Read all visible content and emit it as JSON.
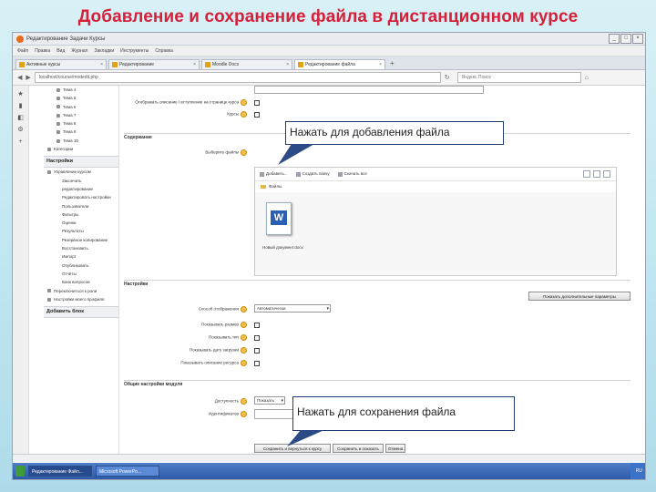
{
  "slide": {
    "title": "Добавление и сохранение файла в дистанционном курсе"
  },
  "browser": {
    "window_title": "Редактирование Задачи Курсы",
    "menu": [
      "Файл",
      "Правка",
      "Вид",
      "Журнал",
      "Закладки",
      "Инструменты",
      "Справка"
    ],
    "tabs": [
      {
        "label": "Активные курсы"
      },
      {
        "label": "Редактирование"
      },
      {
        "label": "Moodle Docs"
      },
      {
        "label": "Редактирование файла"
      }
    ],
    "url": "localhost/course/modedit.php",
    "search_placeholder": "Яндекс.Поиск"
  },
  "sidebar": {
    "topics": [
      "Тема 4",
      "Тема 5",
      "Тема 6",
      "Тема 7",
      "Тема 8",
      "Тема 9",
      "Тема 10",
      "Категории"
    ],
    "settings_title": "Настройки",
    "settings_items": [
      {
        "label": "Управление курсом",
        "level": 0
      },
      {
        "label": "Закончить",
        "level": 1
      },
      {
        "label": "редактирование",
        "level": 1
      },
      {
        "label": "Редактировать настройки",
        "level": 1
      },
      {
        "label": "Пользователи",
        "level": 1
      },
      {
        "label": "Фильтры",
        "level": 1
      },
      {
        "label": "Оценки",
        "level": 1
      },
      {
        "label": "Результаты",
        "level": 1
      },
      {
        "label": "Резервное копирование",
        "level": 1
      },
      {
        "label": "Восстановить",
        "level": 1
      },
      {
        "label": "Импорт",
        "level": 1
      },
      {
        "label": "Опубликовать",
        "level": 1
      },
      {
        "label": "Отчёты",
        "level": 1
      },
      {
        "label": "Банк вопросов",
        "level": 1
      },
      {
        "label": "Переключиться к роли",
        "level": 0
      },
      {
        "label": "Настройки моего профиля",
        "level": 0
      }
    ],
    "add_block": "Добавить блок"
  },
  "form": {
    "checkbox_label_1": "Отображать описание / вступление на странице курса",
    "checkbox_label_2": "Курсы",
    "content_section": "Содержание",
    "select_files_label": "Выберите файлы",
    "fm_toolbar": [
      "Добавить...",
      "Создать папку",
      "Скачать все"
    ],
    "fm_path": "Файлы",
    "file_name": "Новый документ.docx",
    "settings_section": "Настройки",
    "display_label": "Способ отображения",
    "display_value": "Автоматически",
    "rows": [
      "Показывать размер",
      "Показывать тип",
      "Показывать дату загрузки",
      "Показывать описание ресурса"
    ],
    "show_more": "Показать дополнительные параметры",
    "common_section": "Общие настройки модуля",
    "visible_label": "Доступность",
    "visible_value": "Показать",
    "idnumber_label": "Идентификатор",
    "save_return": "Сохранить и вернуться к курсу",
    "save_show": "Сохранить и показать",
    "cancel": "Отмена"
  },
  "callouts": {
    "add": "Нажать для добавления файла",
    "save": "Нажать для сохранения файла"
  },
  "taskbar": {
    "buttons": [
      "Редактирование Файл...",
      "Microsoft PowerPo..."
    ],
    "tray": "RU"
  },
  "colors": {
    "title_red": "#d61f39",
    "callout_border": "#1f3d73",
    "background": "#bfe6f0"
  }
}
